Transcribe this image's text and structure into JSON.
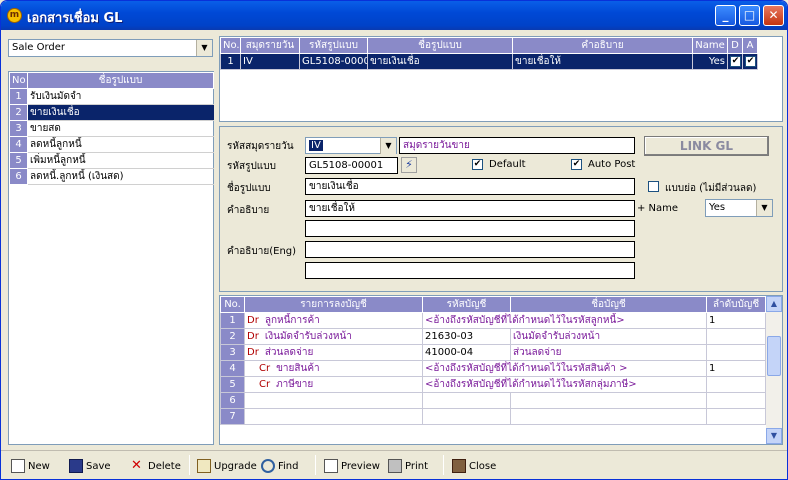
{
  "window": {
    "title": "เอกสารเชื่อม GL",
    "accent": "#0a246a"
  },
  "module_select": {
    "value": "Sale Order"
  },
  "template_list": {
    "headers": [
      "No",
      "ชื่อรูปแบบ"
    ],
    "rows": [
      {
        "no": "1",
        "name": "รับเงินมัดจำ",
        "selected": false
      },
      {
        "no": "2",
        "name": "ขายเงินเชื่อ",
        "selected": true
      },
      {
        "no": "3",
        "name": "ขายสด",
        "selected": false
      },
      {
        "no": "4",
        "name": "ลดหนี้ลูกหนี้",
        "selected": false
      },
      {
        "no": "5",
        "name": "เพิ่มหนี้ลูกหนี้",
        "selected": false
      },
      {
        "no": "6",
        "name": "ลดหนี้.ลูกหนี้ (เงินสด)",
        "selected": false
      }
    ]
  },
  "header_grid": {
    "headers": [
      "No.",
      "สมุดรายวัน",
      "รหัสรูปแบบ",
      "ชื่อรูปแบบ",
      "คำอธิบาย",
      "Name",
      "D",
      "A"
    ],
    "rows": [
      {
        "no": "1",
        "journal": "IV",
        "code": "GL5108-0000",
        "name": "ขายเงินเชื่อ",
        "desc": "ขายเชื่อให้",
        "nm": "Yes",
        "d": "✔",
        "a": "✔"
      }
    ]
  },
  "form": {
    "journal_code_label": "รหัสสมุดรายวัน",
    "journal_code_value": "IV",
    "journal_name": "สมุดรายวันขาย",
    "link_button": "LINK GL",
    "format_code_label": "รหัสรูปแบบ",
    "format_code_value": "GL5108-00001",
    "default_label": "Default",
    "auto_post_label": "Auto Post",
    "format_name_label": "ชื่อรูปแบบ",
    "format_name_value": "ขายเงินเชื่อ",
    "frequent_label": "แบบย่อ (ไม่มีส่วนลด)",
    "description_label": "คำอธิบาย",
    "description_value": "ขายเชื่อให้",
    "name_label": "+ Name",
    "name_value": "Yes",
    "description_eng_label": "คำอธิบาย(Eng)"
  },
  "entries_grid": {
    "headers": [
      "No.",
      "รายการลงบัญชี",
      "รหัสบัญชี",
      "ชื่อบัญชี",
      "ลำดับบัญชี"
    ],
    "rows": [
      {
        "no": "1",
        "side": "Dr",
        "item": "ลูกหนี้การค้า",
        "code": "<อ้างถึงรหัสบัญชีที่ได้กำหนดไว้ในรหัสลูกหนี้>",
        "name": "",
        "seq": "1",
        "indent": false,
        "span": true
      },
      {
        "no": "2",
        "side": "Dr",
        "item": "เงินมัดจำรับล่วงหน้า",
        "code": "21630-03",
        "name": "เงินมัดจำรับล่วงหน้า",
        "seq": "",
        "indent": false,
        "span": false
      },
      {
        "no": "3",
        "side": "Dr",
        "item": "ส่วนลดจ่าย",
        "code": "41000-04",
        "name": "ส่วนลดจ่าย",
        "seq": "",
        "indent": false,
        "span": false
      },
      {
        "no": "4",
        "side": "Cr",
        "item": "ขายสินค้า",
        "code": "<อ้างถึงรหัสบัญชีที่ได้กำหนดไว้ในรหัสสินค้า >",
        "name": "",
        "seq": "1",
        "indent": true,
        "span": true
      },
      {
        "no": "5",
        "side": "Cr",
        "item": "ภาษีขาย",
        "code": "<อ้างถึงรหัสบัญชีที่ได้กำหนดไว้ในรหัสกลุ่มภาษี>",
        "name": "",
        "seq": "",
        "indent": true,
        "span": true
      },
      {
        "no": "6",
        "side": "",
        "item": "",
        "code": "",
        "name": "",
        "seq": "",
        "indent": false,
        "span": false
      },
      {
        "no": "7",
        "side": "",
        "item": "",
        "code": "",
        "name": "",
        "seq": "",
        "indent": false,
        "span": false
      }
    ]
  },
  "toolbar": {
    "new": "New",
    "save": "Save",
    "delete": "Delete",
    "upgrade": "Upgrade",
    "find": "Find",
    "preview": "Preview",
    "print": "Print",
    "close": "Close"
  }
}
